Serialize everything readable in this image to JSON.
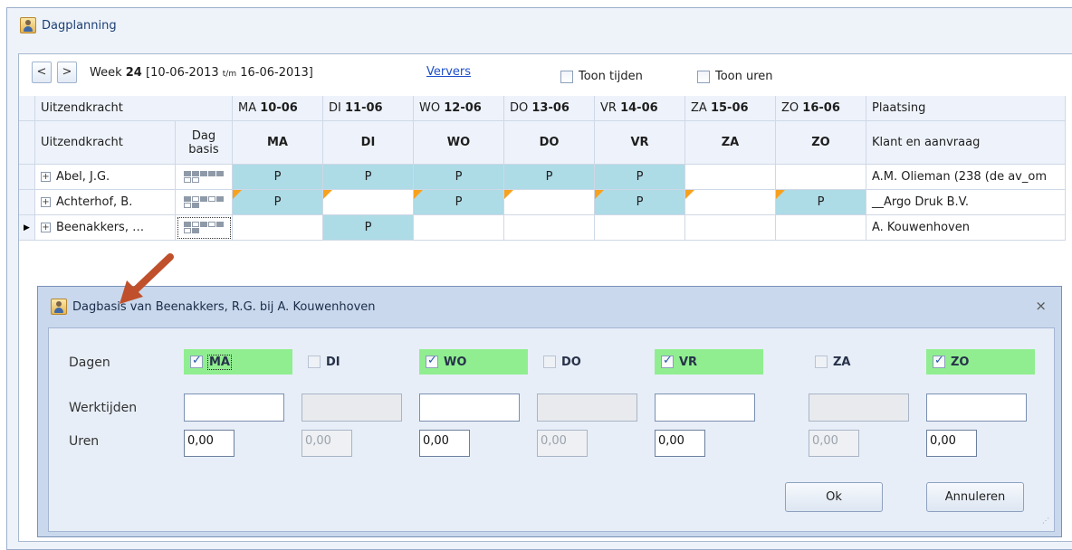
{
  "window": {
    "title": "Dagplanning",
    "icon": "person-icon"
  },
  "toolbar": {
    "prev": "<",
    "next": ">",
    "week_prefix": "Week",
    "week_number": "24",
    "range_start": "[10-06-2013",
    "range_sep": "t/m",
    "range_end": "16-06-2013]",
    "refresh": "Ververs",
    "toon_tijden": "Toon tijden",
    "toon_uren": "Toon uren"
  },
  "grid": {
    "header1": {
      "uitzendkracht": "Uitzendkracht",
      "days": [
        {
          "prefix": "MA",
          "date": "10-06"
        },
        {
          "prefix": "DI",
          "date": "11-06"
        },
        {
          "prefix": "WO",
          "date": "12-06"
        },
        {
          "prefix": "DO",
          "date": "13-06"
        },
        {
          "prefix": "VR",
          "date": "14-06"
        },
        {
          "prefix": "ZA",
          "date": "15-06"
        },
        {
          "prefix": "ZO",
          "date": "16-06"
        }
      ],
      "plaatsing": "Plaatsing"
    },
    "header2": {
      "uitzendkracht": "Uitzendkracht",
      "dagbasis_1": "Dag",
      "dagbasis_2": "basis",
      "days": [
        "MA",
        "DI",
        "WO",
        "DO",
        "VR",
        "ZA",
        "ZO"
      ],
      "klant": "Klant en aanvraag"
    },
    "rows": [
      {
        "name": "Abel, J.G.",
        "days": [
          "P",
          "P",
          "P",
          "P",
          "P",
          "",
          ""
        ],
        "plaatsing": "A.M. Olieman (238 (de av_om"
      },
      {
        "name": "Achterhof, B.",
        "days": [
          "P",
          "",
          "P",
          "",
          "P",
          "",
          "P"
        ],
        "plaatsing": "__Argo Druk B.V."
      },
      {
        "name": "Beenakkers, …",
        "days": [
          "",
          "P",
          "",
          "",
          "",
          "",
          ""
        ],
        "plaatsing": "A. Kouwenhoven"
      }
    ],
    "current_row_marker": "▶"
  },
  "dialog": {
    "title": "Dagbasis van Beenakkers, R.G. bij A. Kouwenhoven",
    "close": "⨯",
    "label_dagen": "Dagen",
    "label_werktijden": "Werktijden",
    "label_uren": "Uren",
    "days": [
      {
        "label": "MA",
        "checked": true
      },
      {
        "label": "DI",
        "checked": false
      },
      {
        "label": "WO",
        "checked": true
      },
      {
        "label": "DO",
        "checked": false
      },
      {
        "label": "VR",
        "checked": true
      },
      {
        "label": "ZA",
        "checked": false
      },
      {
        "label": "ZO",
        "checked": true
      }
    ],
    "uren": [
      "0,00",
      "0,00",
      "0,00",
      "0,00",
      "0,00",
      "0,00",
      "0,00"
    ],
    "ok": "Ok",
    "cancel": "Annuleren"
  },
  "colors": {
    "planned": "#addbe6",
    "checked_day": "#90ee90",
    "flag": "#f7a11e",
    "arrow": "#c0502b"
  }
}
